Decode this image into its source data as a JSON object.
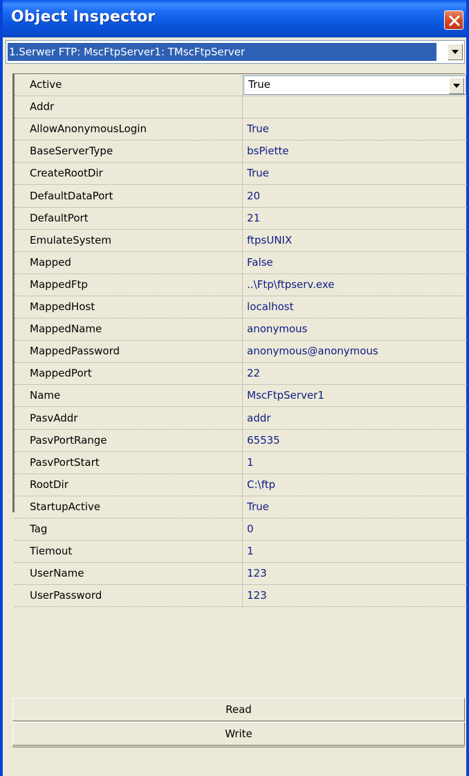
{
  "window": {
    "title": "Object Inspector"
  },
  "selector": {
    "value": "1.Serwer FTP: MscFtpServer1: TMscFtpServer"
  },
  "properties": [
    {
      "name": "Active",
      "value": "True"
    },
    {
      "name": "Addr",
      "value": ""
    },
    {
      "name": "AllowAnonymousLogin",
      "value": "True"
    },
    {
      "name": "BaseServerType",
      "value": "bsPiette"
    },
    {
      "name": "CreateRootDir",
      "value": "True"
    },
    {
      "name": "DefaultDataPort",
      "value": "20"
    },
    {
      "name": "DefaultPort",
      "value": "21"
    },
    {
      "name": "EmulateSystem",
      "value": "ftpsUNIX"
    },
    {
      "name": "Mapped",
      "value": "False"
    },
    {
      "name": "MappedFtp",
      "value": "..\\Ftp\\ftpserv.exe"
    },
    {
      "name": "MappedHost",
      "value": "localhost"
    },
    {
      "name": "MappedName",
      "value": "anonymous"
    },
    {
      "name": "MappedPassword",
      "value": "anonymous@anonymous"
    },
    {
      "name": "MappedPort",
      "value": "22"
    },
    {
      "name": "Name",
      "value": "MscFtpServer1"
    },
    {
      "name": "PasvAddr",
      "value": "addr"
    },
    {
      "name": "PasvPortRange",
      "value": "65535"
    },
    {
      "name": "PasvPortStart",
      "value": "1"
    },
    {
      "name": "RootDir",
      "value": "C:\\ftp"
    },
    {
      "name": "StartupActive",
      "value": "True"
    },
    {
      "name": "Tag",
      "value": "0"
    },
    {
      "name": "Tiemout",
      "value": "1"
    },
    {
      "name": "UserName",
      "value": "123"
    },
    {
      "name": "UserPassword",
      "value": "123"
    }
  ],
  "buttons": {
    "read": "Read",
    "write": "Write"
  },
  "colors": {
    "titlebar": "#0a58e0",
    "value_text": "#0c1c84",
    "selection": "#2e61b4"
  },
  "icons": {
    "close": "close-icon",
    "dropdown": "chevron-down-icon"
  }
}
